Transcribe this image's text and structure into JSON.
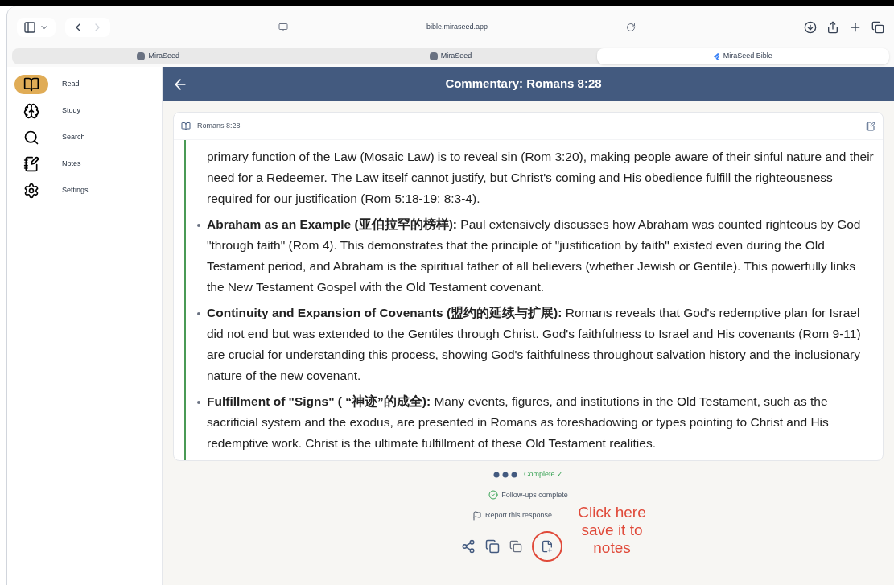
{
  "browser": {
    "url": "bible.miraseed.app",
    "tabs": [
      {
        "label": "MiraSeed",
        "selected": false,
        "kind": "m"
      },
      {
        "label": "MiraSeed",
        "selected": false,
        "kind": "m"
      },
      {
        "label": "MiraSeed Bible",
        "selected": true,
        "kind": "flutter"
      }
    ]
  },
  "sidebar": {
    "items": [
      {
        "label": "Read",
        "selected": true
      },
      {
        "label": "Study",
        "selected": false
      },
      {
        "label": "Search",
        "selected": false
      },
      {
        "label": "Notes",
        "selected": false
      },
      {
        "label": "Settings",
        "selected": false
      }
    ]
  },
  "header": {
    "title": "Commentary: Romans 8:28"
  },
  "card": {
    "reference": "Romans 8:28",
    "items": [
      {
        "text": "primary function of the Law (Mosaic Law) is to reveal sin (Rom 3:20), making people aware of their sinful nature and their need for a Redeemer. The Law itself cannot justify, but Christ's coming and His obedience fulfill the righteousness required for our justification (Rom 5:18-19; 8:3-4)."
      },
      {
        "heading": "Abraham as an Example (亚伯拉罕的榜样):",
        "text": "Paul extensively discusses how Abraham was counted righteous by God \"through faith\" (Rom 4). This demonstrates that the principle of \"justification by faith\" existed even during the Old Testament period, and Abraham is the spiritual father of all believers (whether Jewish or Gentile). This powerfully links the New Testament Gospel with the Old Testament covenant."
      },
      {
        "heading": "Continuity and Expansion of Covenants (盟约的延续与扩展):",
        "text": "Romans reveals that God's redemptive plan for Israel did not end but was extended to the Gentiles through Christ. God's faithfulness to Israel and His covenants (Rom 9-11) are crucial for understanding this process, showing God's faithfulness throughout salvation history and the inclusionary nature of the new covenant."
      },
      {
        "heading": "Fulfillment of \"Signs\" ( “神迹”的成全):",
        "text": "Many events, figures, and institutions in the Old Testament, such as the sacrificial system and the exodus, are presented in Romans as foreshadowing or types pointing to Christ and His redemptive work. Christ is the ultimate fulfillment of these Old Testament realities."
      }
    ]
  },
  "status": {
    "complete": "Complete ✓",
    "followups": "Follow-ups complete",
    "report": "Report this response"
  },
  "annotation": {
    "text": "Click here save it to notes"
  }
}
